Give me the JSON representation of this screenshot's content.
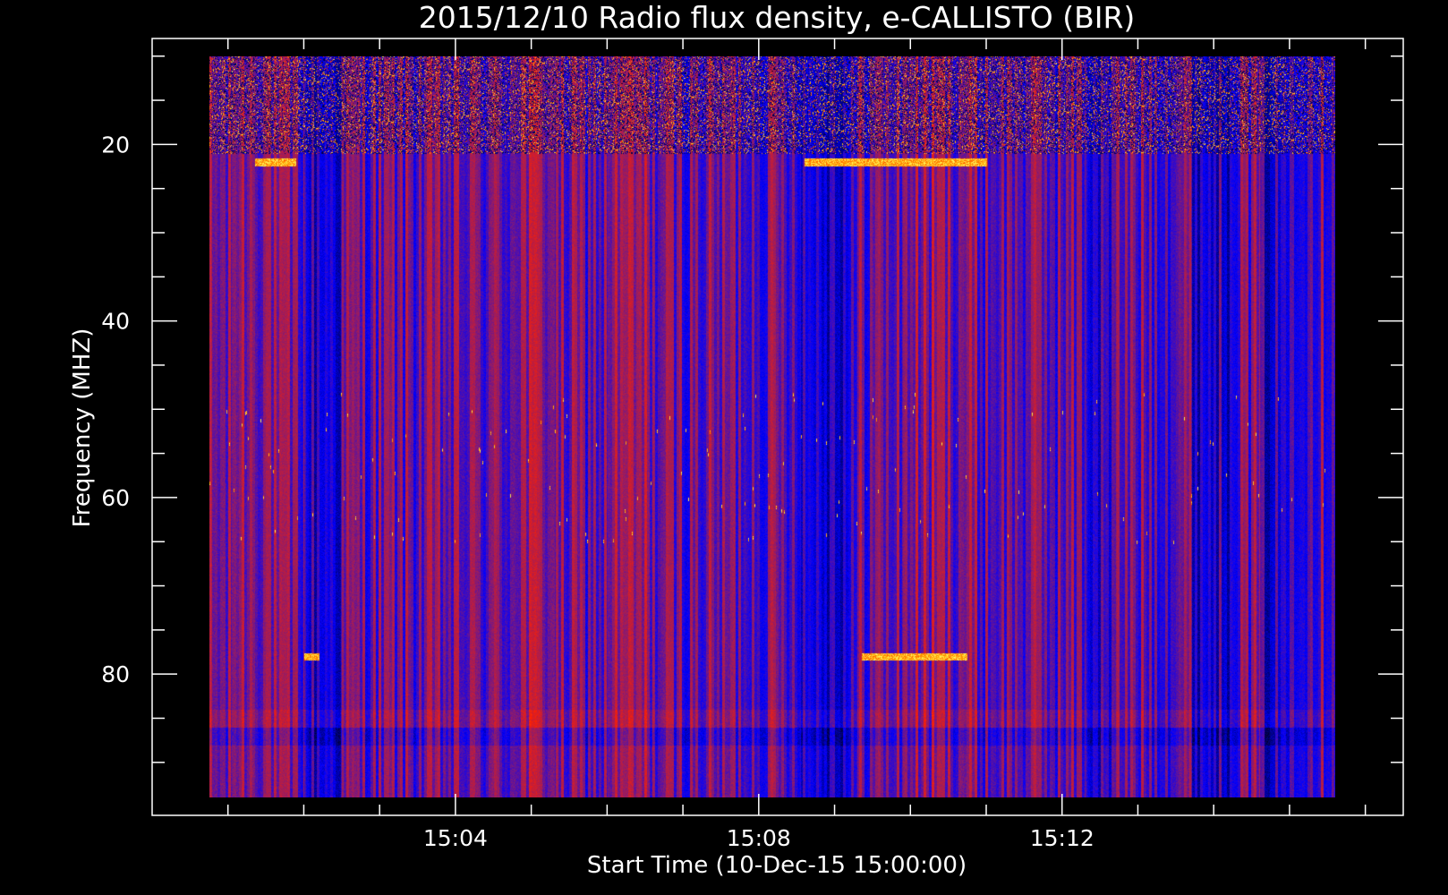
{
  "chart_data": {
    "type": "heatmap",
    "title": "2015/12/10  Radio flux density, e-CALLISTO (BIR)",
    "xlabel": "Start Time (10-Dec-15 15:00:00)",
    "ylabel": "Frequency (MHZ)",
    "x_axis": {
      "unit": "minutes after 15:00:00",
      "range_min": [
        0.0,
        16.5
      ],
      "data_range_min": [
        0.75,
        15.6
      ],
      "ticks": [
        {
          "t": 4,
          "label": "15:04"
        },
        {
          "t": 8,
          "label": "15:08"
        },
        {
          "t": 12,
          "label": "15:12"
        }
      ],
      "minor_tick_step_min": 1
    },
    "y_axis": {
      "unit": "MHz",
      "inverted": true,
      "range_mhz": [
        8,
        96
      ],
      "data_range_mhz": [
        10,
        94
      ],
      "ticks": [
        {
          "v": 20,
          "label": "20"
        },
        {
          "v": 40,
          "label": "40"
        },
        {
          "v": 60,
          "label": "60"
        },
        {
          "v": 80,
          "label": "80"
        }
      ],
      "minor_tick_step_mhz": 5
    },
    "colormap": [
      "#000000",
      "#0000ff",
      "#8b1b6e",
      "#ff2000",
      "#ffa000",
      "#ffff66"
    ],
    "features": [
      {
        "kind": "narrowband-interference",
        "freq_mhz": 78,
        "t_start_min": 2.0,
        "t_end_min": 2.2
      },
      {
        "kind": "narrowband-interference",
        "freq_mhz": 78,
        "t_start_min": 9.35,
        "t_end_min": 10.75
      },
      {
        "kind": "narrowband-interference",
        "freq_mhz": 22,
        "t_start_min": 1.35,
        "t_end_min": 1.9
      },
      {
        "kind": "narrowband-interference",
        "freq_mhz": 22,
        "t_start_min": 8.6,
        "t_end_min": 11.0
      },
      {
        "kind": "strong-rfi-band",
        "freq_mhz_range": [
          10,
          21
        ]
      }
    ]
  }
}
